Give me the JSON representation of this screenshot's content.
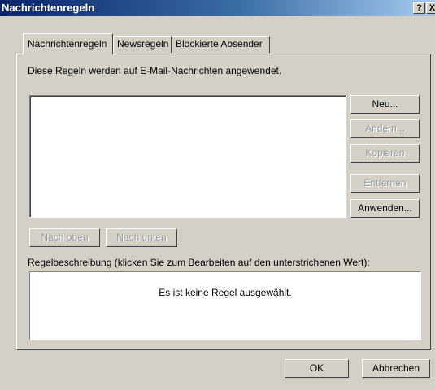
{
  "window": {
    "title": "Nachrichtenregeln",
    "help_glyph": "?",
    "close_glyph": "X"
  },
  "tabs": [
    {
      "label": "Nachrichtenregeln",
      "active": true
    },
    {
      "label": "Newsregeln",
      "active": false
    },
    {
      "label": "Blockierte Absender",
      "active": false
    }
  ],
  "panel": {
    "intro_text": "Diese Regeln werden auf E-Mail-Nachrichten angewendet.",
    "rules_list": [],
    "side_buttons": [
      {
        "label": "Neu...",
        "enabled": true
      },
      {
        "label": "Ändern...",
        "enabled": false
      },
      {
        "label": "Kopieren",
        "enabled": false
      },
      {
        "label": "Entfernen",
        "enabled": false
      },
      {
        "label": "Anwenden...",
        "enabled": true
      }
    ],
    "move_up_label": "Nach oben",
    "move_down_label": "Nach unten",
    "description_label": "Regelbeschreibung (klicken Sie zum Bearbeiten auf den unterstrichenen Wert):",
    "description_text": "Es ist keine Regel ausgewählt."
  },
  "footer": {
    "ok_label": "OK",
    "cancel_label": "Abbrechen"
  }
}
